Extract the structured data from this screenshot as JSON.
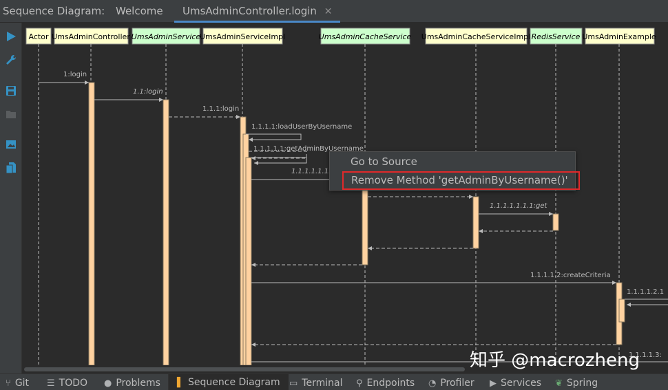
{
  "title": "Sequence Diagram:",
  "tabs": [
    {
      "label": "Welcome"
    },
    {
      "label": "UmsAdminController.login"
    }
  ],
  "toolbar": {
    "icons": [
      "run-icon",
      "wrench-icon",
      "save-icon",
      "folder-icon",
      "image-icon",
      "document-icon"
    ]
  },
  "lifelines": [
    {
      "label": "Actor",
      "kind": "class"
    },
    {
      "label": "UmsAdminController",
      "kind": "class"
    },
    {
      "label": "UmsAdminService",
      "kind": "interface"
    },
    {
      "label": "UmsAdminServiceImpl",
      "kind": "class"
    },
    {
      "label": "UmsAdminCacheService",
      "kind": "interface"
    },
    {
      "label": "UmsAdminCacheServiceImpl",
      "kind": "class"
    },
    {
      "label": "RedisService",
      "kind": "interface"
    },
    {
      "label": "UmsAdminExample",
      "kind": "class"
    }
  ],
  "messages": [
    {
      "label": "1:login"
    },
    {
      "label": "1.1:login"
    },
    {
      "label": "1.1.1:login"
    },
    {
      "label": "1.1.1.1:loadUserByUsername"
    },
    {
      "label": "1.1.1.1.1:getAdminByUsername"
    },
    {
      "label": "1.1.1.1.1.1:"
    },
    {
      "label": "1.1.1.1.1.1.1:get"
    },
    {
      "label": "1.1.1.1.2:createCriteria"
    },
    {
      "label": "1.1.1.1.2.1"
    },
    {
      "label": "1.1.1.1.3:"
    }
  ],
  "context_menu": {
    "items": [
      {
        "label": "Go to Source"
      },
      {
        "label": "Remove Method 'getAdminByUsername()'"
      }
    ]
  },
  "status_bar": {
    "items": [
      {
        "label": "Git",
        "icon": "branch-icon"
      },
      {
        "label": "TODO",
        "icon": "list-icon"
      },
      {
        "label": "Problems",
        "icon": "problems-icon"
      },
      {
        "label": "Sequence Diagram",
        "icon": "sequence-icon"
      },
      {
        "label": "Terminal",
        "icon": "terminal-icon"
      },
      {
        "label": "Endpoints",
        "icon": "endpoints-icon"
      },
      {
        "label": "Profiler",
        "icon": "profiler-icon"
      },
      {
        "label": "Services",
        "icon": "services-icon"
      },
      {
        "label": "Spring",
        "icon": "spring-icon"
      }
    ]
  },
  "watermark": "知乎 @macrozheng",
  "colors": {
    "class_box": "#ffffcc",
    "interface_box": "#ccffcc",
    "activation": "#ffd2a0",
    "accent": "#4a88c7",
    "highlight": "#e0292a"
  }
}
